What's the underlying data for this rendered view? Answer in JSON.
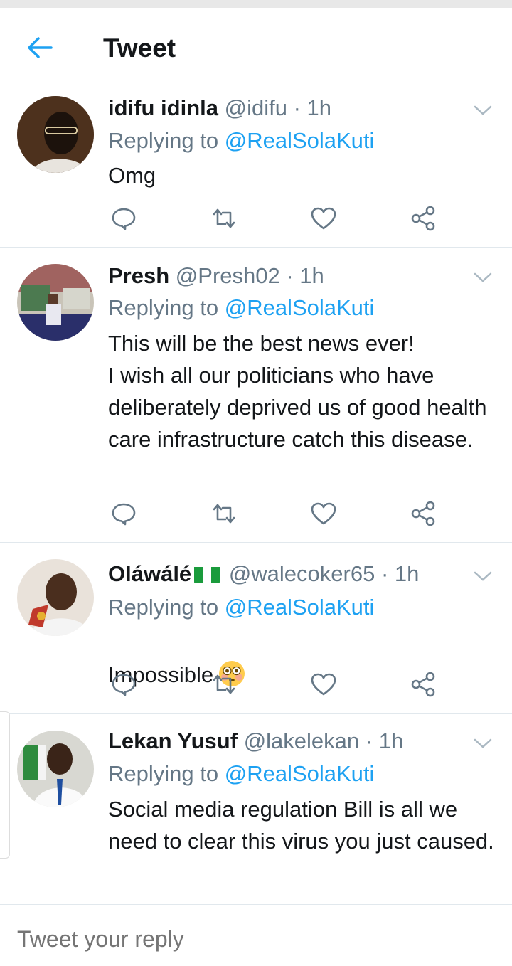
{
  "header": {
    "title": "Tweet"
  },
  "tweets": [
    {
      "name": "idifu idinla",
      "handle": "@idifu",
      "time": "1h",
      "replying_label": "Replying to",
      "replying_to": "@RealSolaKuti",
      "text": "Omg"
    },
    {
      "name": "Presh",
      "handle": "@Presh02",
      "time": "1h",
      "replying_label": "Replying to",
      "replying_to": "@RealSolaKuti",
      "text": "This will be the best news ever!\nI wish all our politicians who have deliberately deprived us of good health care infrastructure catch this disease."
    },
    {
      "name": "Oláwálé",
      "handle": "@walecoker65",
      "time": "1h",
      "replying_label": "Replying to",
      "replying_to": "@RealSolaKuti",
      "text": "Impossible"
    },
    {
      "name": "Lekan Yusuf",
      "handle": "@lakelekan",
      "time": "1h",
      "replying_label": "Replying to",
      "replying_to": "@RealSolaKuti",
      "text": "Social media regulation Bill is all we need to clear this virus you just caused."
    }
  ],
  "composer": {
    "placeholder": "Tweet your reply"
  },
  "icons": {
    "back": "arrow-left-icon",
    "caret": "chevron-down-icon",
    "reply": "comment-icon",
    "retweet": "retweet-icon",
    "like": "heart-icon",
    "share": "share-icon",
    "flag": "nigeria-flag-icon",
    "emoji": "flushed-face-emoji"
  },
  "colors": {
    "accent": "#1da1f2",
    "secondary": "#657786",
    "text": "#14171a",
    "divider": "#e1e8ed"
  }
}
